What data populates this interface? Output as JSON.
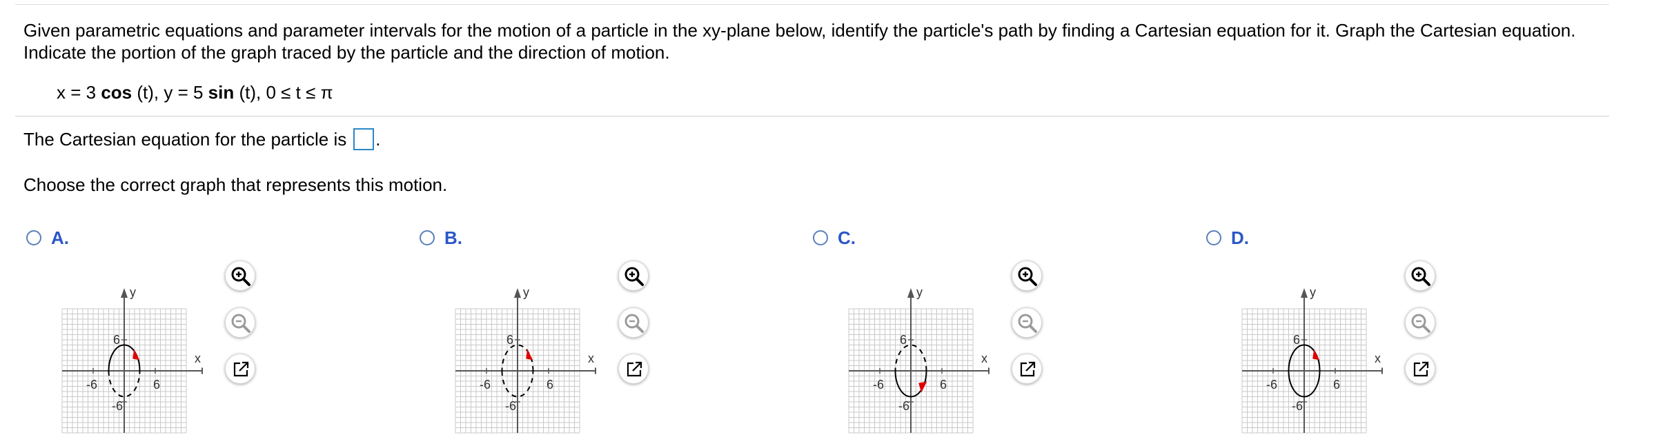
{
  "question": {
    "prompt": "Given parametric equations and parameter intervals for the motion of a particle in the xy-plane below, identify the particle's path by finding a Cartesian equation for it. Graph the Cartesian equation. Indicate the portion of the graph traced by the particle and the direction of motion.",
    "equation": {
      "x_prefix": "x = 3 ",
      "x_func": "cos",
      "x_suffix": " (t), y = 5 ",
      "y_func": "sin",
      "y_suffix": " (t), 0 ≤ t ≤ π"
    },
    "answer_prefix": "The Cartesian equation for the particle is",
    "answer_value": "",
    "answer_suffix": ".",
    "choose_text": "Choose the correct graph that represents this motion."
  },
  "options": [
    {
      "letter": "A.",
      "selected": false,
      "traced": "top-solid",
      "arrow": "top-right"
    },
    {
      "letter": "B.",
      "selected": false,
      "traced": "all-dashed",
      "arrow": "top-right"
    },
    {
      "letter": "C.",
      "selected": false,
      "traced": "bottom-solid",
      "arrow": "bottom-right"
    },
    {
      "letter": "D.",
      "selected": false,
      "traced": "all-solid",
      "arrow": "top-right"
    }
  ],
  "graph_labels": {
    "y_axis": "y",
    "x_axis": "x",
    "y_top": "6",
    "y_bottom": "-6",
    "x_left": "-6",
    "x_right": "6"
  },
  "tools": {
    "zoom_in": "zoom-in-icon",
    "zoom_out": "zoom-out-icon",
    "popout": "popout-icon"
  },
  "colors": {
    "accent": "#2b56c8",
    "arrow": "#e00000",
    "answer_box": "#2a86c9"
  }
}
